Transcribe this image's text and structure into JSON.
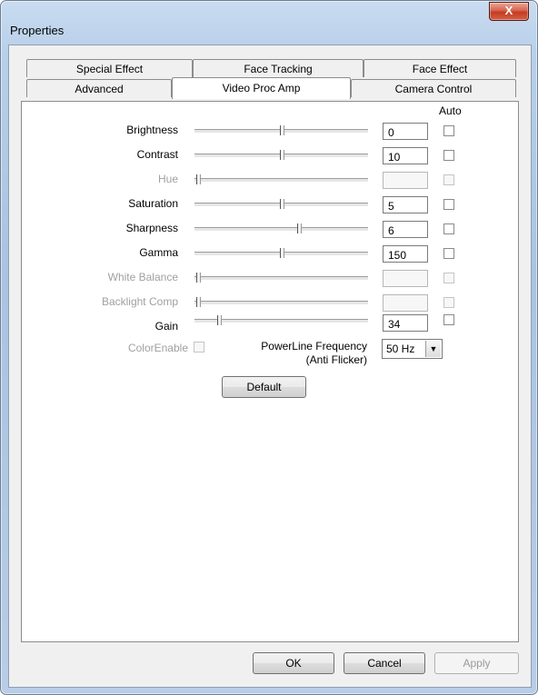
{
  "window": {
    "title": "Properties",
    "close_glyph": "X"
  },
  "tabs": {
    "row1": [
      "Special Effect",
      "Face Tracking",
      "Face Effect"
    ],
    "row2": [
      "Advanced",
      "Video Proc Amp",
      "Camera Control"
    ],
    "active": "Video Proc Amp"
  },
  "auto_header": "Auto",
  "controls": [
    {
      "label": "Brightness",
      "value": "0",
      "enabled": true,
      "level": 0.5
    },
    {
      "label": "Contrast",
      "value": "10",
      "enabled": true,
      "level": 0.5
    },
    {
      "label": "Hue",
      "value": "",
      "enabled": false,
      "level": 0
    },
    {
      "label": "Saturation",
      "value": "5",
      "enabled": true,
      "level": 0.5
    },
    {
      "label": "Sharpness",
      "value": "6",
      "enabled": true,
      "level": 0.6
    },
    {
      "label": "Gamma",
      "value": "150",
      "enabled": true,
      "level": 0.5
    },
    {
      "label": "White Balance",
      "value": "",
      "enabled": false,
      "level": 0
    },
    {
      "label": "Backlight Comp",
      "value": "",
      "enabled": false,
      "level": 0
    },
    {
      "label": "Gain",
      "value": "34",
      "enabled": true,
      "level": 0.13
    }
  ],
  "color_enable": {
    "label": "ColorEnable",
    "enabled": false
  },
  "powerline": {
    "label_line1": "PowerLine Frequency",
    "label_line2": "(Anti Flicker)",
    "value": "50 Hz"
  },
  "default_button": "Default",
  "footer": {
    "ok": "OK",
    "cancel": "Cancel",
    "apply": "Apply"
  },
  "colors": {
    "close_button": "#c63a21",
    "disabled_text": "#a0a0a0"
  }
}
